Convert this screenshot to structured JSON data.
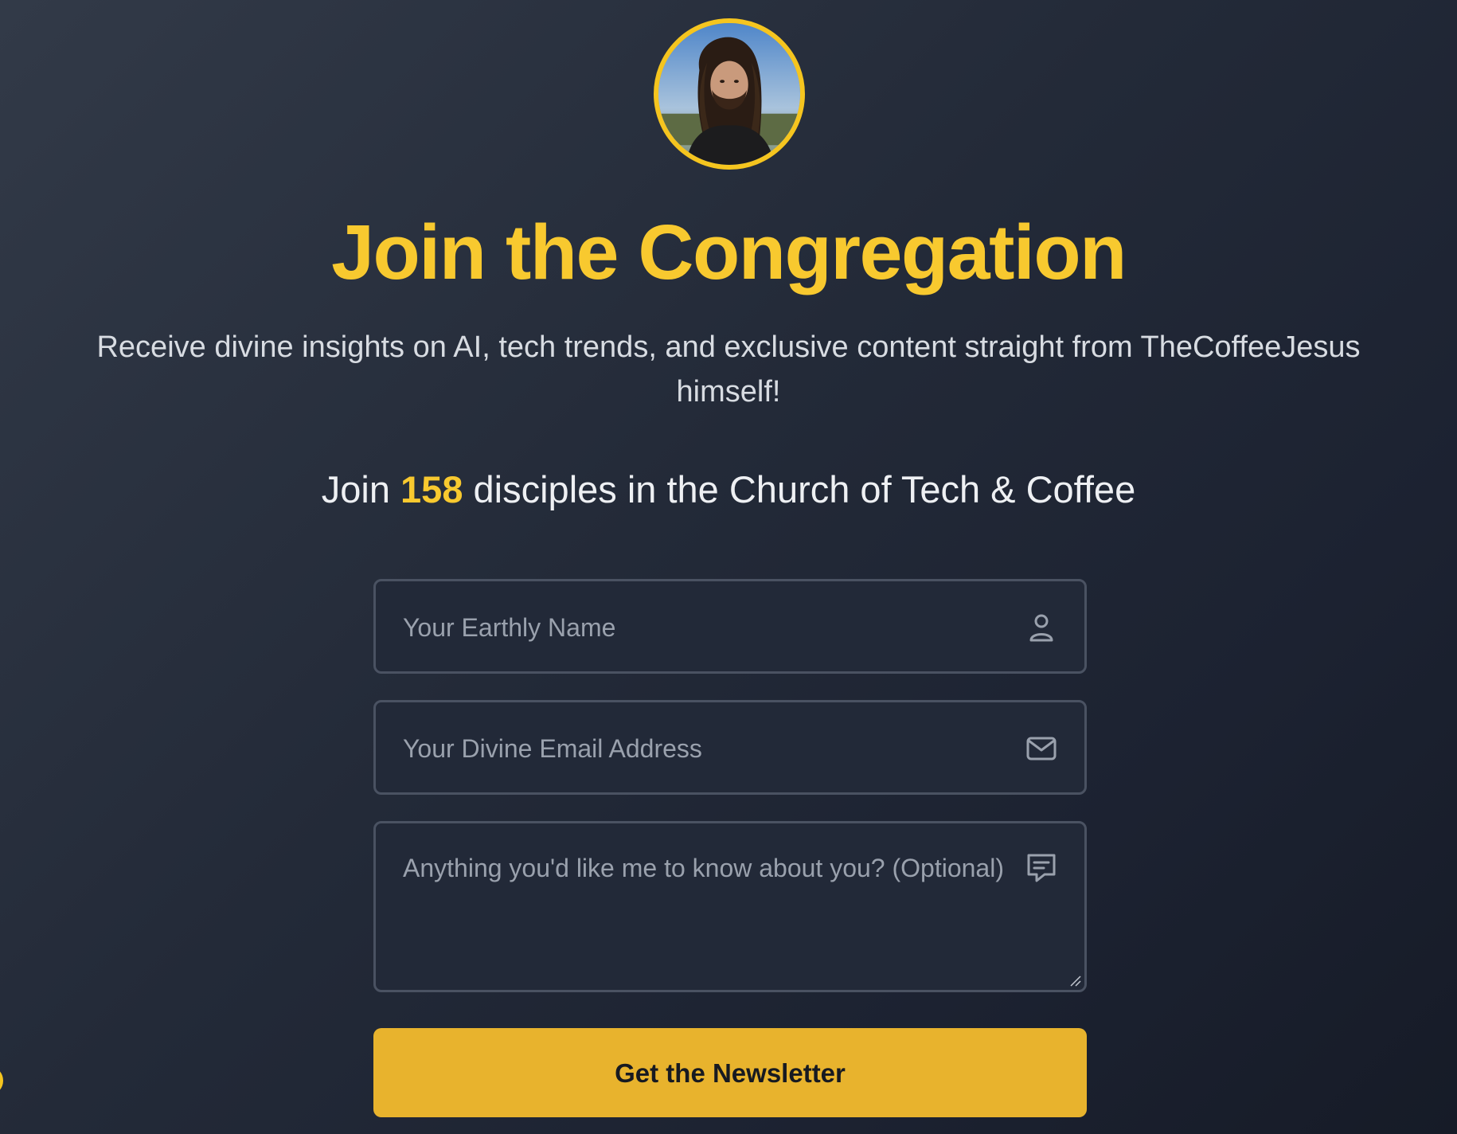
{
  "hero": {
    "title": "Join the Congregation",
    "subtitle": "Receive divine insights on AI, tech trends, and exclusive content straight from TheCoffeeJesus himself!",
    "stats_prefix": "Join ",
    "stats_count": "158",
    "stats_suffix": " disciples in the Church of Tech & Coffee"
  },
  "form": {
    "name_placeholder": "Your Earthly Name",
    "email_placeholder": "Your Divine Email Address",
    "message_placeholder": "Anything you'd like me to know about you? (Optional)",
    "submit_label": "Get the Newsletter"
  },
  "icons": {
    "name": "user-icon",
    "email": "mail-icon",
    "message": "chat-bubble-icon"
  },
  "colors": {
    "accent": "#f8c92f",
    "button": "#e8b32d",
    "field_border": "#4a5262",
    "background": "#232a38"
  }
}
